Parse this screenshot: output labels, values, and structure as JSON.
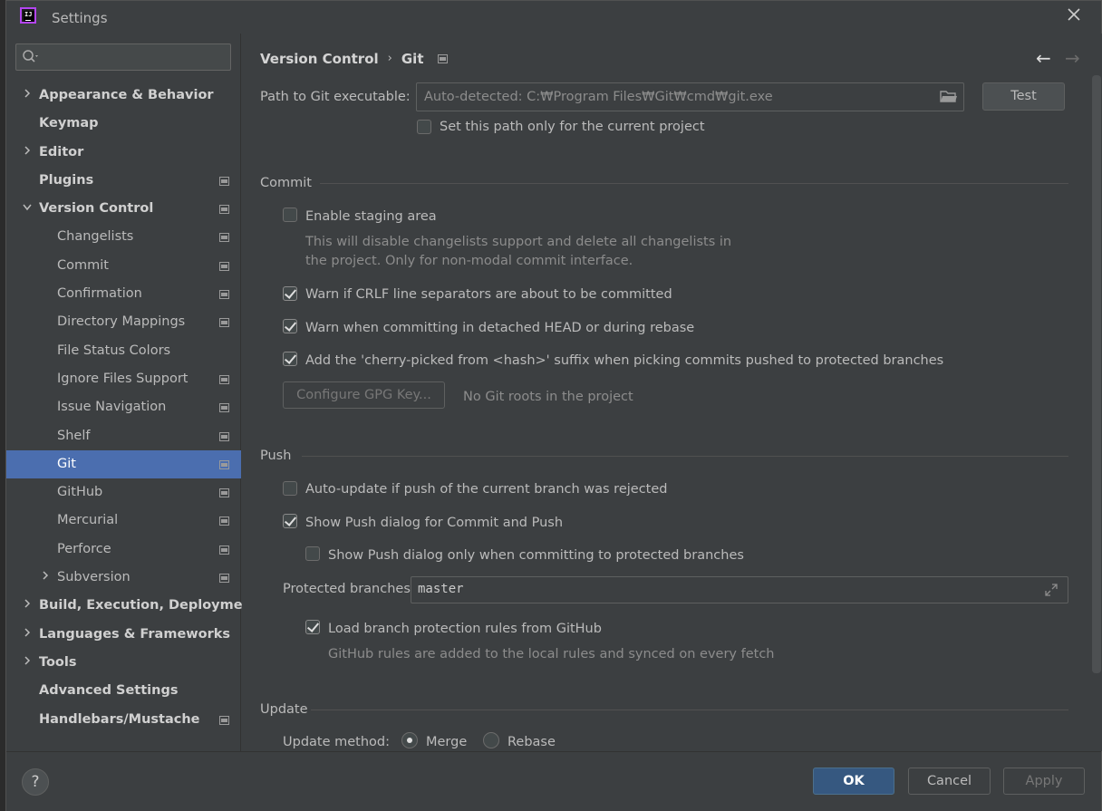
{
  "window": {
    "title": "Settings"
  },
  "sidebar": {
    "search": {
      "value": "",
      "placeholder": ""
    },
    "items": [
      {
        "label": "Appearance & Behavior",
        "level": 0,
        "chevron": "right",
        "project_icon": false,
        "selected": false
      },
      {
        "label": "Keymap",
        "level": 0,
        "chevron": "",
        "project_icon": false,
        "selected": false
      },
      {
        "label": "Editor",
        "level": 0,
        "chevron": "right",
        "project_icon": false,
        "selected": false
      },
      {
        "label": "Plugins",
        "level": 0,
        "chevron": "",
        "project_icon": true,
        "selected": false
      },
      {
        "label": "Version Control",
        "level": 0,
        "chevron": "down",
        "project_icon": true,
        "selected": false
      },
      {
        "label": "Changelists",
        "level": 1,
        "chevron": "",
        "project_icon": true,
        "selected": false
      },
      {
        "label": "Commit",
        "level": 1,
        "chevron": "",
        "project_icon": true,
        "selected": false
      },
      {
        "label": "Confirmation",
        "level": 1,
        "chevron": "",
        "project_icon": true,
        "selected": false
      },
      {
        "label": "Directory Mappings",
        "level": 1,
        "chevron": "",
        "project_icon": true,
        "selected": false
      },
      {
        "label": "File Status Colors",
        "level": 1,
        "chevron": "",
        "project_icon": false,
        "selected": false
      },
      {
        "label": "Ignore Files Support",
        "level": 1,
        "chevron": "",
        "project_icon": true,
        "selected": false
      },
      {
        "label": "Issue Navigation",
        "level": 1,
        "chevron": "",
        "project_icon": true,
        "selected": false
      },
      {
        "label": "Shelf",
        "level": 1,
        "chevron": "",
        "project_icon": true,
        "selected": false
      },
      {
        "label": "Git",
        "level": 1,
        "chevron": "",
        "project_icon": true,
        "selected": true
      },
      {
        "label": "GitHub",
        "level": 1,
        "chevron": "",
        "project_icon": true,
        "selected": false
      },
      {
        "label": "Mercurial",
        "level": 1,
        "chevron": "",
        "project_icon": true,
        "selected": false
      },
      {
        "label": "Perforce",
        "level": 1,
        "chevron": "",
        "project_icon": true,
        "selected": false
      },
      {
        "label": "Subversion",
        "level": 1,
        "chevron": "right",
        "project_icon": true,
        "selected": false
      },
      {
        "label": "Build, Execution, Deployment",
        "level": 0,
        "chevron": "right",
        "project_icon": false,
        "selected": false
      },
      {
        "label": "Languages & Frameworks",
        "level": 0,
        "chevron": "right",
        "project_icon": false,
        "selected": false
      },
      {
        "label": "Tools",
        "level": 0,
        "chevron": "right",
        "project_icon": false,
        "selected": false
      },
      {
        "label": "Advanced Settings",
        "level": 0,
        "chevron": "",
        "project_icon": false,
        "selected": false
      },
      {
        "label": "Handlebars/Mustache",
        "level": 0,
        "chevron": "",
        "project_icon": true,
        "selected": false
      }
    ]
  },
  "breadcrumb": {
    "parent": "Version Control",
    "separator": "›",
    "current": "Git"
  },
  "nav": {
    "back": "←",
    "forward": "→"
  },
  "git": {
    "path_label": "Path to Git executable:",
    "path_placeholder": "Auto-detected: C:₩Program Files₩Git₩cmd₩git.exe",
    "path_value": "",
    "test_button": "Test",
    "current_project_only": {
      "label": "Set this path only for the current project",
      "checked": false
    }
  },
  "commit": {
    "title": "Commit",
    "staging": {
      "label": "Enable staging area",
      "checked": false
    },
    "staging_hint_1": "This will disable changelists support and delete all changelists in",
    "staging_hint_2": "the project. Only for non-modal commit interface.",
    "crlf": {
      "label": "Warn if CRLF line separators are about to be committed",
      "checked": true
    },
    "detached": {
      "label": "Warn when committing in detached HEAD or during rebase",
      "checked": true
    },
    "cherry": {
      "label": "Add the 'cherry-picked from <hash>' suffix when picking commits pushed to protected branches",
      "checked": true
    },
    "gpg_button": "Configure GPG Key...",
    "gpg_status": "No Git roots in the project"
  },
  "push": {
    "title": "Push",
    "auto_update": {
      "label": "Auto-update if push of the current branch was rejected",
      "checked": false
    },
    "show_dialog": {
      "label": "Show Push dialog for Commit and Push",
      "checked": true
    },
    "only_protected": {
      "label": "Show Push dialog only when committing to protected branches",
      "checked": false
    },
    "protected_label": "Protected branches:",
    "protected_value": "master",
    "load_rules": {
      "label": "Load branch protection rules from GitHub",
      "checked": true
    },
    "load_rules_hint": "GitHub rules are added to the local rules and synced on every fetch"
  },
  "update": {
    "title": "Update",
    "method_label": "Update method:",
    "merge": {
      "label": "Merge",
      "checked": true
    },
    "rebase": {
      "label": "Rebase",
      "checked": false
    }
  },
  "footer": {
    "help": "?",
    "ok": "OK",
    "cancel": "Cancel",
    "apply": "Apply"
  }
}
